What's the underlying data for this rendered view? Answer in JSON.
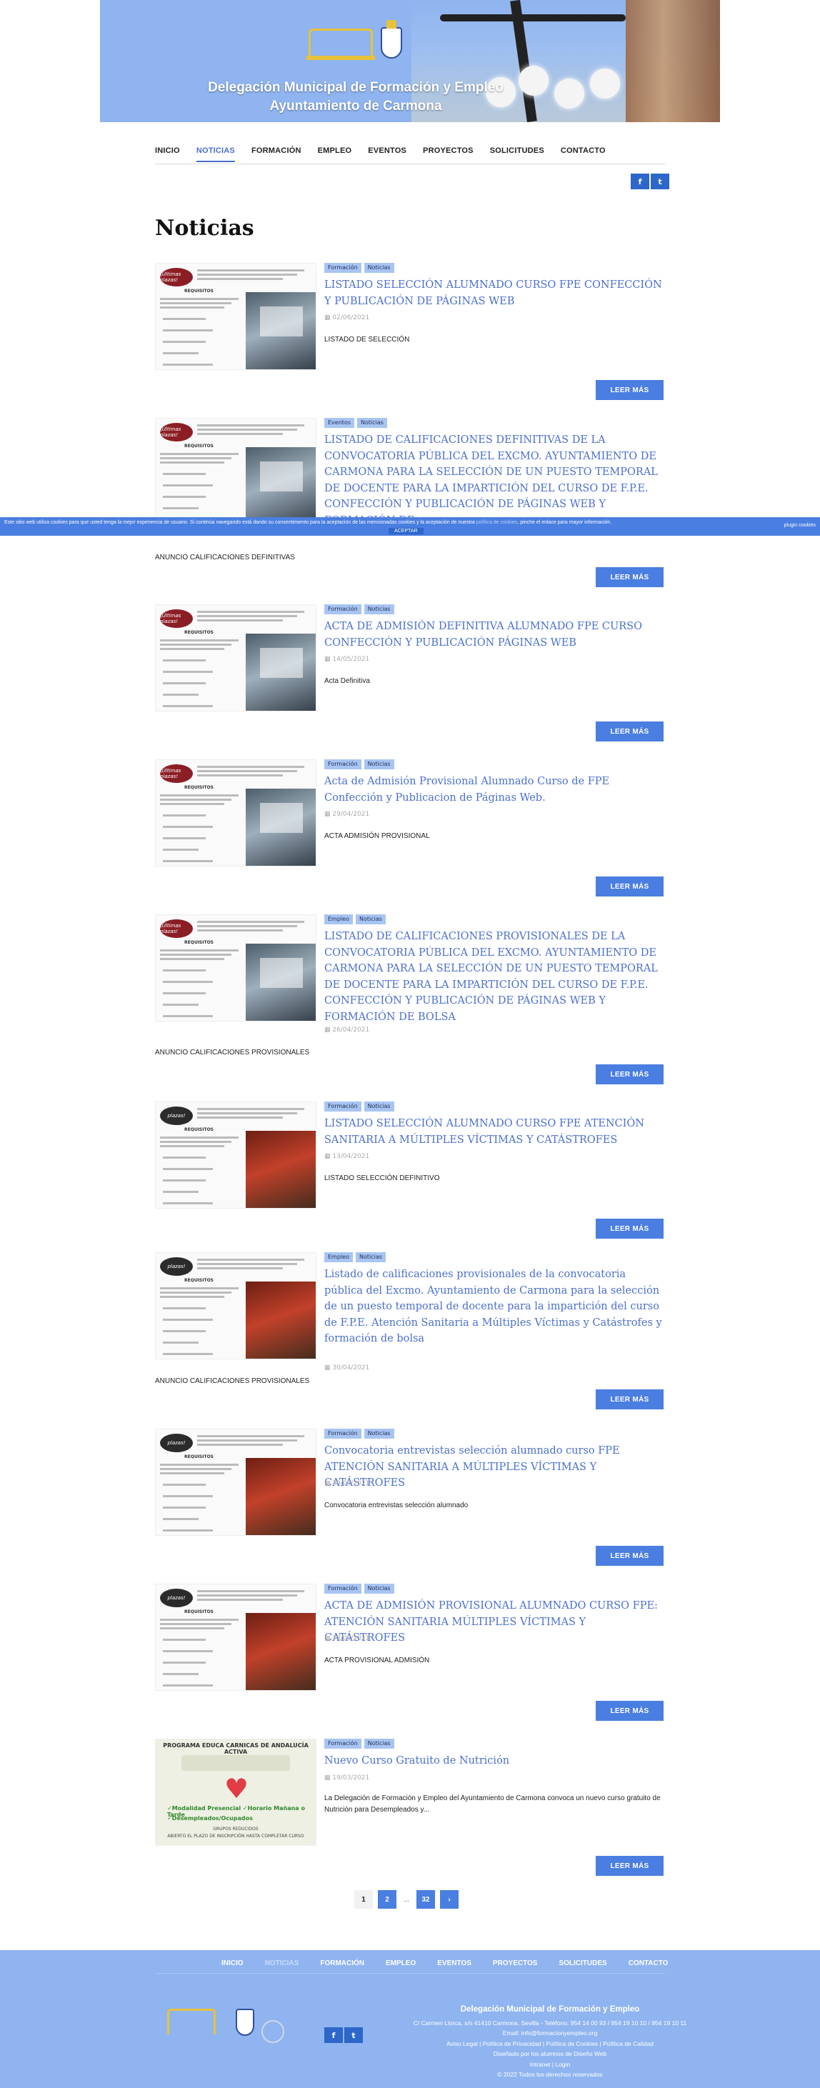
{
  "header": {
    "title_line1": "Delegación Municipal de Formación y Empleo",
    "title_line2": "Ayuntamiento de Carmona"
  },
  "nav": {
    "items": [
      "INICIO",
      "NOTICIAS",
      "FORMACIÓN",
      "EMPLEO",
      "EVENTOS",
      "PROYECTOS",
      "SOLICITUDES",
      "CONTACTO"
    ],
    "active": "NOTICIAS"
  },
  "social": {
    "facebook_icon": "f",
    "twitter_icon": "t"
  },
  "page_title": "Noticias",
  "cookie": {
    "text": "Este sitio web utiliza cookies para que usted tenga la mejor experiencia de usuario. Si continúa navegando está dando su consentimiento para la aceptación de las mencionadas cookies y la aceptación de nuestra",
    "link": "política de cookies",
    "text_end": ", pinche el enlace para mayor información.",
    "accept": "ACEPTAR",
    "privacy": "plugin cookies"
  },
  "posts": [
    {
      "tags": [
        "Formación",
        "Noticias"
      ],
      "title": "LISTADO SELECCIÓN ALUMNADO CURSO FPE CONFECCIÓN Y PUBLICACIÓN DE PÁGINAS WEB",
      "date": "02/06/2021",
      "excerpt": "LISTADO DE SELECCIÓN",
      "extra": "",
      "more": "LEER MÁS"
    },
    {
      "tags": [
        "Eventos",
        "Noticias"
      ],
      "title": "LISTADO DE CALIFICACIONES DEFINITIVAS DE LA CONVOCATORIA PÚBLICA DEL EXCMO. AYUNTAMIENTO DE CARMONA PARA LA SELECCIÓN DE UN PUESTO TEMPORAL DE DOCENTE PARA LA IMPARTICIÓN DEL CURSO DE F.P.E. CONFECCIÓN Y PUBLICACIÓN DE PÁGINAS WEB Y FORMACIÓN DE",
      "date": "",
      "excerpt": "",
      "extra": "ANUNCIO CALIFICACIONES DEFINITIVAS",
      "more": "LEER MÁS"
    },
    {
      "tags": [
        "Formación",
        "Noticias"
      ],
      "title": "ACTA DE ADMISIÓN DEFINITIVA ALUMNADO FPE CURSO CONFECCIÓN Y PUBLICACIÓN PÁGINAS WEB",
      "date": "14/05/2021",
      "excerpt": "Acta Definitiva",
      "extra": "",
      "more": "LEER MÁS"
    },
    {
      "tags": [
        "Formación",
        "Noticias"
      ],
      "title": "Acta de Admisión Provisional Alumnado Curso de FPE Confección y Publicacion de Páginas Web.",
      "date": "29/04/2021",
      "excerpt": "ACTA ADMISIÓN PROVISIONAL",
      "extra": "",
      "more": "LEER MÁS"
    },
    {
      "tags": [
        "Empleo",
        "Noticias"
      ],
      "title": "LISTADO DE CALIFICACIONES PROVISIONALES DE LA CONVOCATORIA PÚBLICA DEL EXCMO. AYUNTAMIENTO DE CARMONA PARA LA SELECCIÓN DE UN PUESTO TEMPORAL DE DOCENTE PARA LA IMPARTICIÓN DEL CURSO DE F.P.E. CONFECCIÓN Y PUBLICACIÓN DE PÁGINAS WEB Y FORMACIÓN DE BOLSA",
      "date": "26/04/2021",
      "excerpt": "",
      "extra": "ANUNCIO CALIFICACIONES PROVISIONALES",
      "more": "LEER MÁS"
    },
    {
      "tags": [
        "Formación",
        "Noticias"
      ],
      "title": "LISTADO SELECCIÓN ALUMNADO CURSO FPE ATENCIÓN SANITARIA A MÚLTIPLES VÍCTIMAS Y CATÁSTROFES",
      "date": "13/04/2021",
      "excerpt": "LISTADO SELECCIÓN DEFINITIVO",
      "extra": "",
      "more": "LEER MÁS"
    },
    {
      "tags": [
        "Empleo",
        "Noticias"
      ],
      "title": "Listado de calificaciones provisionales de la convocatoria pública del Excmo. Ayuntamiento de Carmona para la selección de un puesto temporal de docente para la impartición del curso de F.P.E. Atención Sanitaria a Múltiples Víctimas y Catástrofes y formación de bolsa",
      "date": "30/04/2021",
      "excerpt": "",
      "extra": "ANUNCIO CALIFICACIONES PROVISIONALES",
      "more": "LEER MÁS"
    },
    {
      "tags": [
        "Formación",
        "Noticias"
      ],
      "title": "Convocatoria entrevistas selección alumnado curso FPE ATENCIÓN SANITARIA A MÚLTIPLES VÍCTIMAS Y CATÁSTROFES",
      "date": "29/03/2021",
      "excerpt": "Convocatoria entrevistas selección alumnado",
      "extra": "",
      "more": "LEER MÁS"
    },
    {
      "tags": [
        "Formación",
        "Noticias"
      ],
      "title": "ACTA DE ADMISIÓN PROVISIONAL ALUMNADO CURSO FPE: ATENCIÓN SANITARIA MÚLTIPLES VÍCTIMAS Y CATÁSTROFES",
      "date": "23/03/2021",
      "excerpt": "ACTA PROVISIONAL ADMISIÓN",
      "extra": "",
      "more": "LEER MÁS"
    },
    {
      "tags": [
        "Formación",
        "Noticias"
      ],
      "title": "Nuevo Curso Gratuito de Nutrición",
      "date": "19/03/2021",
      "excerpt": "La Delegación de Formación y Empleo del Ayuntamiento de Carmona convoca un nuevo curso gratuito de Nutrición para Desempleados y...",
      "extra": "",
      "more": "LEER MÁS"
    }
  ],
  "thumbs": {
    "web_badge": "¡Últimas plazas!",
    "requisitos": "REQUISITOS",
    "fire_badge": "plazas!",
    "nutri_head": "PROGRAMA EDUCA CARNICAS DE ANDALUCÍA ACTIVA",
    "nutri_c1": "✓Modalidad Presencial ✓Horario Mañana o Tarde",
    "nutri_c2": "✓Desempleados/Ocupados",
    "nutri_foot1": "GRUPOS REDUCIDOS",
    "nutri_foot2": "ABIERTO EL PLAZO DE INSCRIPCIÓN HASTA COMPLETAR CURSO"
  },
  "pagination": {
    "current": "1",
    "next": "2",
    "dots": "...",
    "last": "32",
    "arrow": "›"
  },
  "footer": {
    "nav": [
      "INICIO",
      "NOTICIAS",
      "FORMACIÓN",
      "EMPLEO",
      "EVENTOS",
      "PROYECTOS",
      "SOLICITUDES",
      "CONTACTO"
    ],
    "title": "Delegación Municipal de Formación y Empleo",
    "address": "C/ Carmen Llorca, s/n 41410 Carmona, Sevilla - Teléfono: 954 14 00 93 / 954 19 10 10 / 954 19 10 11",
    "email": "Email: info@formacionyempleo.org",
    "legal": "Aviso Legal | Política de Privacidad | Política de Cookies | Política de Calidad",
    "made": "Diseñado por los alumnos de Diseño Web",
    "admin": "Intranet | Login",
    "copyright": "© 2022 Todos los derechos reservados"
  }
}
